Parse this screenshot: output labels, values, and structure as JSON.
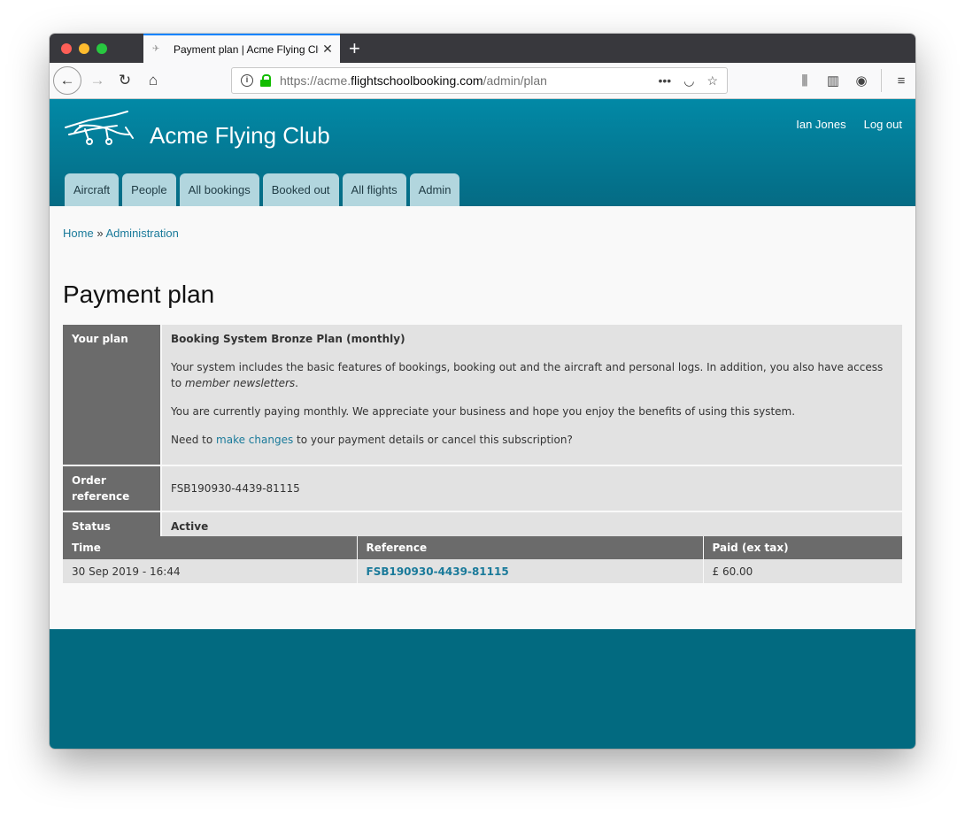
{
  "browser": {
    "tab_title": "Payment plan | Acme Flying Club",
    "url_prefix": "https://acme.",
    "url_host": "flightschoolbooking.com",
    "url_path": "/admin/plan",
    "icons": {
      "back": "←",
      "forward": "→",
      "reload": "↻",
      "home": "⌂",
      "more": "•••",
      "pocket": "◡",
      "bookmark": "☆",
      "library": "⫼",
      "sidebar": "▥",
      "account": "◉",
      "menu": "≡",
      "close_tab": "✕",
      "new_tab": "+"
    }
  },
  "site": {
    "title": "Acme Flying Club",
    "user_name": "Ian Jones",
    "logout_label": "Log out",
    "tabs": [
      "Aircraft",
      "People",
      "All bookings",
      "Booked out",
      "All flights",
      "Admin"
    ]
  },
  "breadcrumb": {
    "home": "Home",
    "separator": "»",
    "current": "Administration"
  },
  "page": {
    "title": "Payment plan"
  },
  "plan": {
    "your_plan_label": "Your plan",
    "plan_name": "Booking System Bronze Plan (monthly)",
    "description_text": "Your system includes the basic features of bookings, booking out and the aircraft and personal logs. In addition, you also have access to ",
    "description_em": "member newsletters",
    "description_end": ".",
    "paying_text": "You are currently paying monthly. We appreciate your business and hope you enjoy the benefits of using this system.",
    "changes_prefix": "Need to ",
    "changes_link": "make changes",
    "changes_suffix": " to your payment details or cancel this subscription?",
    "order_reference_label": "Order reference",
    "order_reference": "FSB190930-4439-81115",
    "status_label": "Status",
    "status": "Active"
  },
  "payments": {
    "headers": [
      "Time",
      "Reference",
      "Paid (ex tax)"
    ],
    "rows": [
      {
        "time": "30 Sep 2019 - 16:44",
        "reference": "FSB190930-4439-81115",
        "paid": "£ 60.00"
      }
    ]
  }
}
